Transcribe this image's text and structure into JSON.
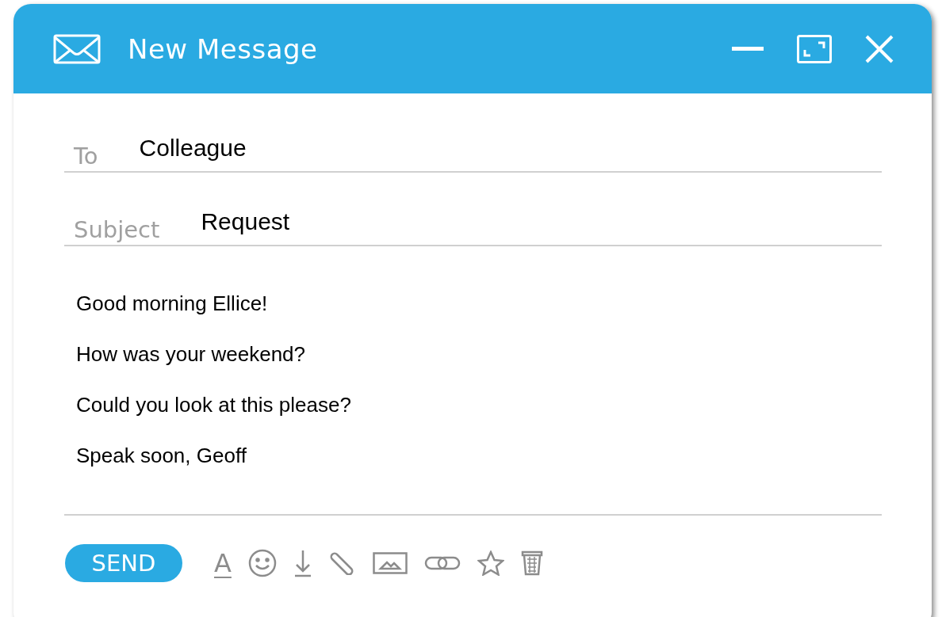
{
  "window": {
    "title": "New Message"
  },
  "fields": [
    {
      "label": "To",
      "value": "Colleague"
    },
    {
      "label": "Subject",
      "value": "Request"
    }
  ],
  "body": [
    "Good morning Ellice!",
    "How was your weekend?",
    "Could you look at this please?",
    "Speak soon, Geoff"
  ],
  "send_button": "SEND",
  "toolbar": [
    {
      "kind": "format",
      "text": "A"
    },
    {
      "kind": "emoji"
    },
    {
      "kind": "download"
    },
    {
      "kind": "attach"
    },
    {
      "kind": "image"
    },
    {
      "kind": "link"
    },
    {
      "kind": "star"
    },
    {
      "kind": "trash"
    }
  ]
}
